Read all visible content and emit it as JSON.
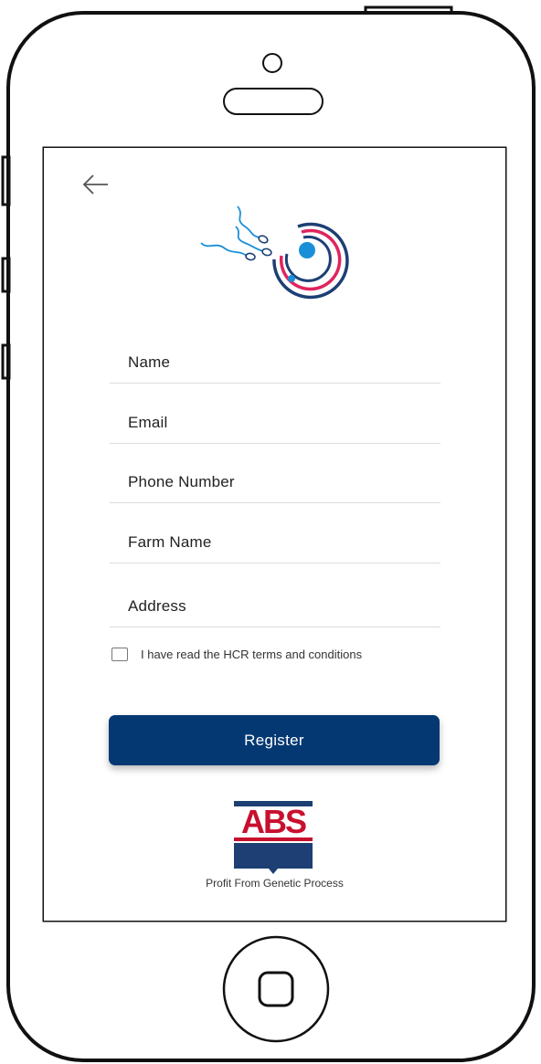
{
  "register_form": {
    "fields": [
      {
        "label": "Name"
      },
      {
        "label": "Email"
      },
      {
        "label": "Phone Number"
      },
      {
        "label": "Farm Name"
      },
      {
        "label": "Address"
      }
    ],
    "terms_label": "I have read the HCR terms and conditions",
    "terms_checked": false,
    "submit_label": "Register"
  },
  "brand": {
    "logo_text": "ABS",
    "tagline": "Profit From Genetic Process"
  },
  "icons": {
    "back": "arrow-left-icon",
    "app_logo": "sperm-egg-logo-icon",
    "home": "home-button-icon"
  },
  "colors": {
    "primary": "#033873",
    "logo_pink": "#e0245e",
    "logo_navy": "#1d3f74",
    "logo_blue": "#1a8fd8",
    "abs_red": "#c8102e"
  }
}
